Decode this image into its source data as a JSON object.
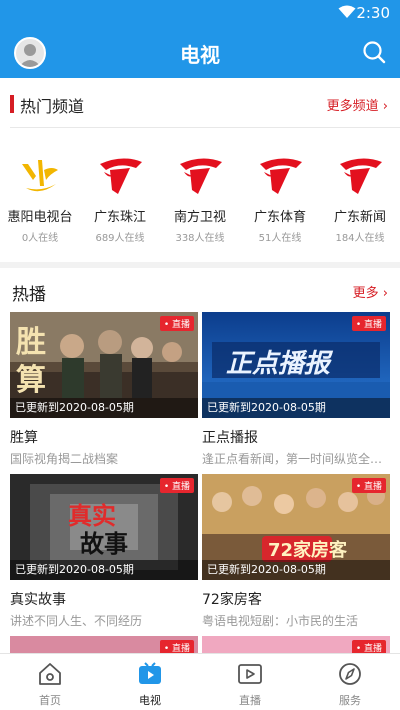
{
  "status": {
    "time": "2:30"
  },
  "header": {
    "title": "电视"
  },
  "hot_channels": {
    "title": "热门频道",
    "more": "更多频道",
    "items": [
      {
        "name": "惠阳电视台",
        "online": "0人在线",
        "logo": "huiyang-tv-logo"
      },
      {
        "name": "广东珠江",
        "online": "689人在线",
        "logo": "gdtv-logo"
      },
      {
        "name": "南方卫视",
        "online": "338人在线",
        "logo": "gdtv-logo"
      },
      {
        "name": "广东体育",
        "online": "51人在线",
        "logo": "gdtv-logo"
      },
      {
        "name": "广东新闻",
        "online": "184人在线",
        "logo": "gdtv-logo"
      }
    ]
  },
  "hot_play": {
    "title": "热播",
    "more": "更多",
    "live_badge": "• 直播",
    "items": [
      {
        "title": "胜算",
        "desc": "国际视角揭二战档案",
        "updated": "已更新到2020-08-05期"
      },
      {
        "title": "正点播报",
        "desc": "逢正点看新闻，第一时间纵览全球…",
        "updated": "已更新到2020-08-05期"
      },
      {
        "title": "真实故事",
        "desc": "讲述不同人生、不同经历",
        "updated": "已更新到2020-08-05期"
      },
      {
        "title": "72家房客",
        "desc": "粤语电视短剧：小市民的生活",
        "updated": "已更新到2020-08-05期"
      }
    ]
  },
  "tabbar": {
    "items": [
      {
        "label": "首页",
        "icon": "home-icon"
      },
      {
        "label": "电视",
        "icon": "tv-icon",
        "active": true
      },
      {
        "label": "直播",
        "icon": "video-icon"
      },
      {
        "label": "服务",
        "icon": "compass-icon"
      }
    ]
  },
  "colors": {
    "primary": "#2196e8",
    "accent": "#d61d24"
  }
}
